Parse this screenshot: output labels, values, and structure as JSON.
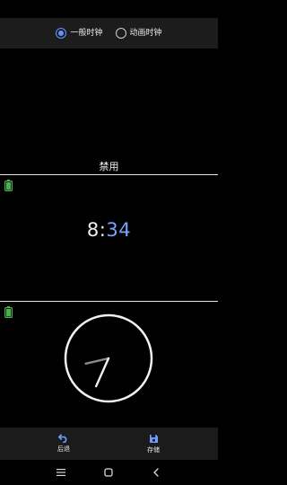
{
  "mode_selector": {
    "options": [
      {
        "label": "一般时钟",
        "selected": true
      },
      {
        "label": "动画时钟",
        "selected": false
      }
    ]
  },
  "panels": {
    "disabled_label": "禁用",
    "digital": {
      "hour": "8",
      "separator": ":",
      "minute": "34"
    },
    "analog": {
      "hour": 8,
      "minute": 34
    }
  },
  "actions": {
    "back_label": "后退",
    "save_label": "存储"
  },
  "colors": {
    "accent": "#5e94ff",
    "minute_digits": "#7aa2ff",
    "battery": "#4caf50"
  },
  "icons": {
    "battery": "battery-icon",
    "back": "undo-icon",
    "save": "floppy-disk-icon",
    "menu": "menu-icon",
    "home": "home-icon",
    "nav_back": "chevron-left-icon"
  }
}
